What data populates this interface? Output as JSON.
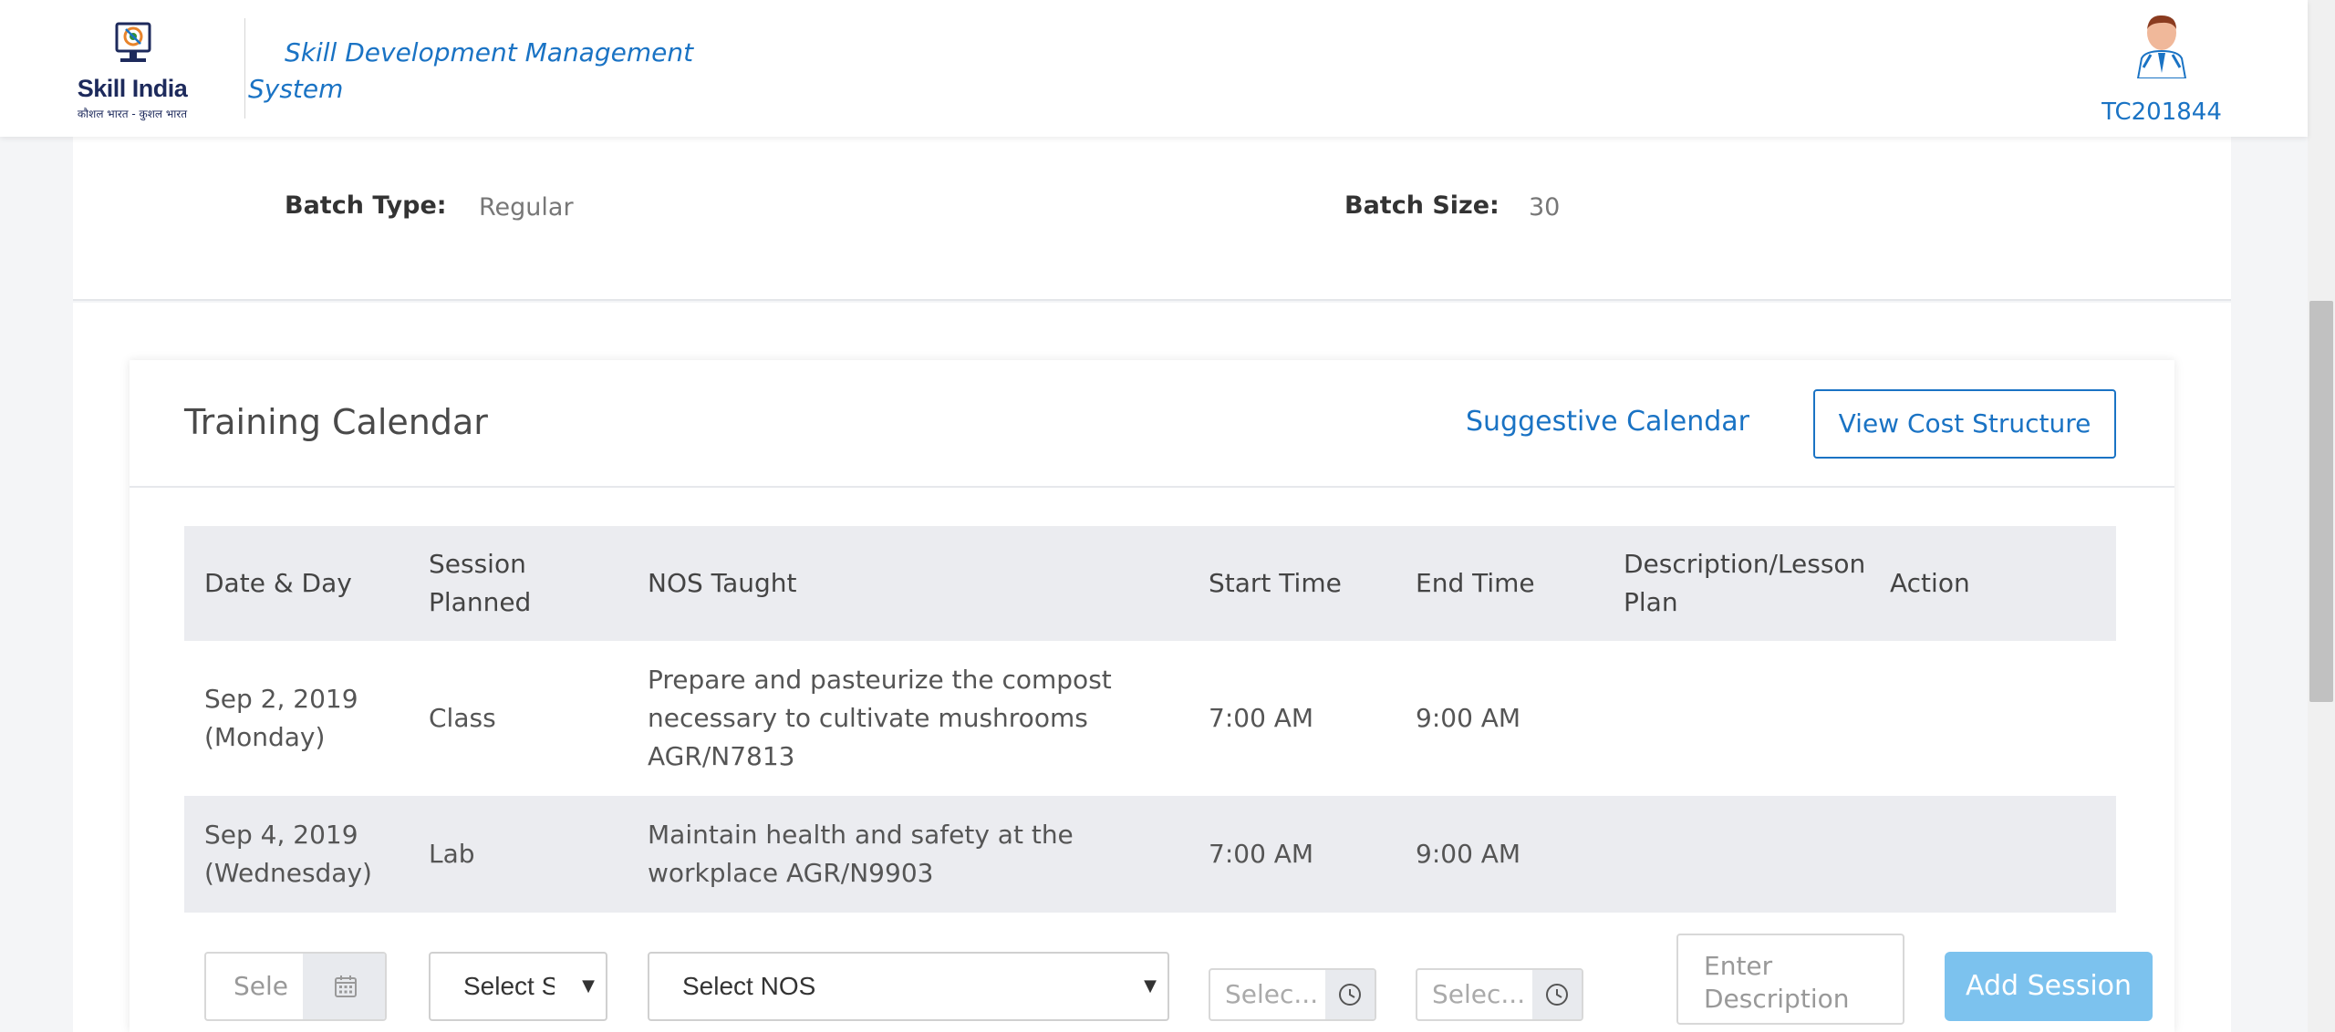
{
  "header": {
    "logo_title": "Skill India",
    "logo_tagline": "कौशल भारत - कुशल भारत",
    "app_title": "Skill Development Management System",
    "user_id": "TC201844"
  },
  "batch_info": {
    "batch_type_label": "Batch Type:",
    "batch_type_value": "Regular",
    "batch_size_label": "Batch Size:",
    "batch_size_value": "30"
  },
  "training_calendar": {
    "title": "Training Calendar",
    "suggestive_link": "Suggestive Calendar",
    "cost_button": "View Cost Structure",
    "columns": [
      "Date & Day",
      "Session Planned",
      "NOS Taught",
      "Start Time",
      "End Time",
      "Description/Lesson Plan",
      "Action"
    ],
    "rows": [
      {
        "date": "Sep 2, 2019 (Monday)",
        "session": "Class",
        "nos": "Prepare and pasteurize the compost necessary to cultivate mushrooms AGR/N7813",
        "start": "7:00 AM",
        "end": "9:00 AM",
        "description": "",
        "action": ""
      },
      {
        "date": "Sep 4, 2019 (Wednesday)",
        "session": "Lab",
        "nos": "Maintain health and safety at the workplace AGR/N9903",
        "start": "7:00 AM",
        "end": "9:00 AM",
        "description": "",
        "action": ""
      }
    ],
    "form": {
      "date_placeholder": "Sele",
      "session_select": "Select S",
      "nos_select": "Select NOS",
      "start_placeholder": "Selec...",
      "end_placeholder": "Selec...",
      "description_placeholder": "Enter Description",
      "add_button": "Add Session"
    }
  },
  "colors": {
    "primary": "#1a73c4",
    "table_header_bg": "#ebecf0",
    "add_button_bg": "#7cc2ee"
  },
  "icons": {
    "calendar": "calendar-icon",
    "clock": "clock-icon",
    "dropdown": "chevron-down-icon"
  }
}
